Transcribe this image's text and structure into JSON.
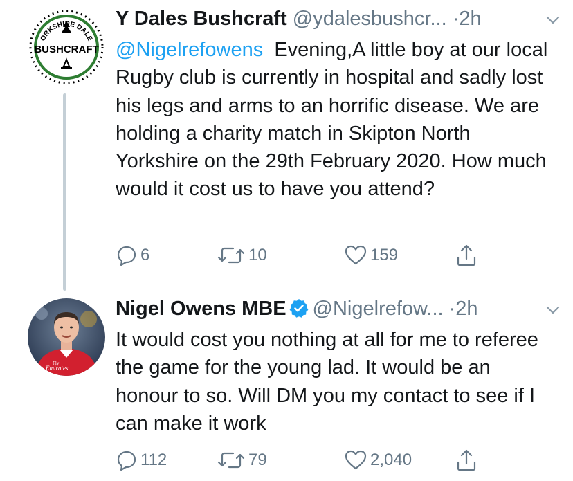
{
  "tweets": [
    {
      "display_name": "Y Dales Bushcraft",
      "handle": "@ydalesbushcr...",
      "separator": "·",
      "time": "2h",
      "avatar_text_top": "YORKSHIRE DALES",
      "avatar_text_main": "BUSHCRAFT",
      "verified": false,
      "mention": "@Nigelrefowens",
      "text": "Evening,A little boy at our local Rugby club is currently in hospital and sadly lost his legs and arms to an horrific disease. We are holding a charity match in Skipton North Yorkshire on the 29th February 2020. How much would it cost us to have you attend?",
      "replies": "6",
      "retweets": "10",
      "likes": "159"
    },
    {
      "display_name": "Nigel Owens MBE",
      "handle": "@Nigelrefow...",
      "separator": "·",
      "time": "2h",
      "avatar_shirt_text_1": "Fly",
      "avatar_shirt_text_2": "Emirates",
      "verified": true,
      "text": "It would cost you nothing at all for me to referee the game for the young lad. It would be an honour to so. Will DM you my contact to see if I can make it work",
      "replies": "112",
      "retweets": "79",
      "likes": "2,040"
    }
  ],
  "icons": {
    "reply": "reply-icon",
    "retweet": "retweet-icon",
    "like": "heart-icon",
    "share": "share-icon",
    "caret": "chevron-down-icon",
    "verified": "verified-badge-icon"
  },
  "colors": {
    "link": "#1da1f2",
    "secondary": "#657786",
    "text": "#14171a",
    "thread_line": "#c4cfd6",
    "avatar_ring": "#2e7d32",
    "shirt_red": "#d2202f"
  }
}
